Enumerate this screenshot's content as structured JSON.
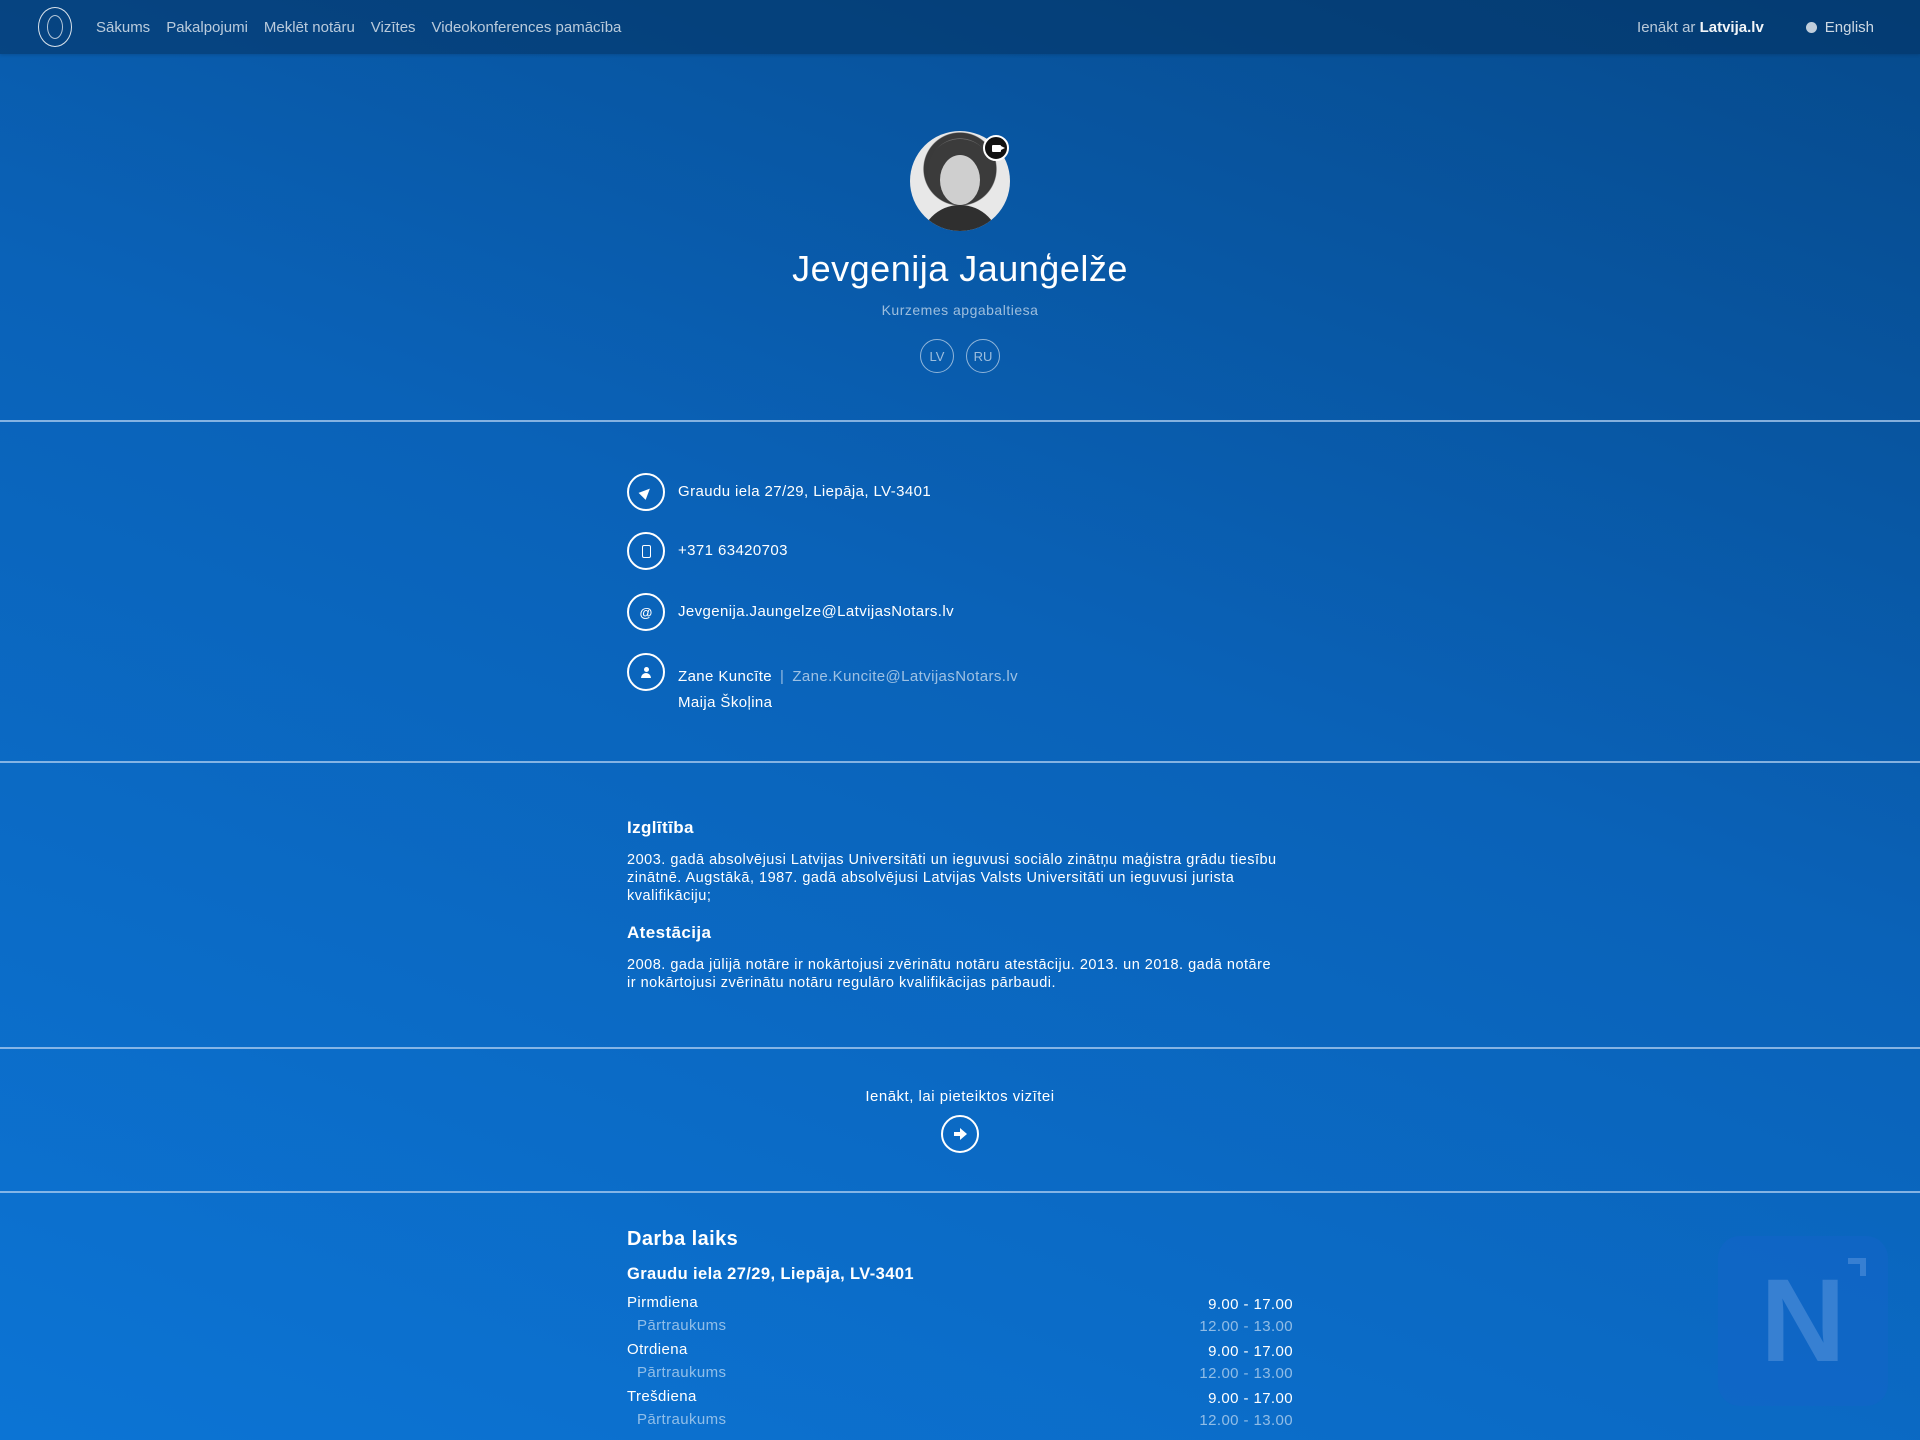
{
  "nav": {
    "links": [
      "Sākums",
      "Pakalpojumi",
      "Meklēt notāru",
      "Vizītes",
      "Videokonferences pamācība"
    ],
    "login_prefix": "Ienākt ar",
    "login_brand": "Latvija.lv",
    "language": "English"
  },
  "profile": {
    "name": "Jevgenija Jaunģelže",
    "court": "Kurzemes apgabaltiesa",
    "languages": [
      "LV",
      "RU"
    ]
  },
  "contacts": {
    "address": "Graudu iela 27/29, Liepāja, LV-3401",
    "phone": "+371 63420703",
    "email": "Jevgenija.Jaungelze@LatvijasNotars.lv",
    "email_icon_glyph": "@",
    "assistants": [
      {
        "name": "Zane Kuncīte",
        "separator": "|",
        "email": "Zane.Kuncite@LatvijasNotars.lv"
      },
      {
        "name": "Maija Škoļina"
      }
    ]
  },
  "bio": {
    "education_heading": "Izglītība",
    "education_text": "2003. gadā absolvējusi Latvijas Universitāti un ieguvusi sociālo zinātņu maģistra grādu tiesību zinātnē. Augstākā, 1987. gadā absolvējusi Latvijas Valsts Universitāti un ieguvusi jurista kvalifikāciju;",
    "attestation_heading": "Atestācija",
    "attestation_text": "2008. gada jūlijā notāre ir nokārtojusi zvērinātu notāru atestāciju. 2013. un 2018. gadā notāre ir nokārtojusi zvērinātu notāru regulāro kvalifikācijas pārbaudi."
  },
  "visit": {
    "label": "Ienākt, lai pieteiktos vizītei"
  },
  "hours": {
    "title": "Darba laiks",
    "address": "Graudu iela 27/29, Liepāja, LV-3401",
    "days": [
      {
        "day": "Pirmdiena",
        "time": "9.00 - 17.00",
        "break_label": "Pārtraukums",
        "break_time": "12.00 - 13.00"
      },
      {
        "day": "Otrdiena",
        "time": "9.00 - 17.00",
        "break_label": "Pārtraukums",
        "break_time": "12.00 - 13.00"
      },
      {
        "day": "Trešdiena",
        "time": "9.00 - 17.00",
        "break_label": "Pārtraukums",
        "break_time": "12.00 - 13.00"
      }
    ]
  },
  "watermark": {
    "letter": "N"
  },
  "icons": {
    "logo": "coat-of-arms-icon",
    "language": "globe-icon",
    "video": "video-camera-icon",
    "address": "location-arrow-icon",
    "phone": "mobile-phone-icon",
    "email": "at-sign-icon",
    "assistant": "user-icon",
    "visit": "arrow-right-icon"
  },
  "colors": {
    "background_top": "#064a8c",
    "background_bottom": "#0c74d4",
    "divider": "#adcef0",
    "text": "#ffffff"
  }
}
